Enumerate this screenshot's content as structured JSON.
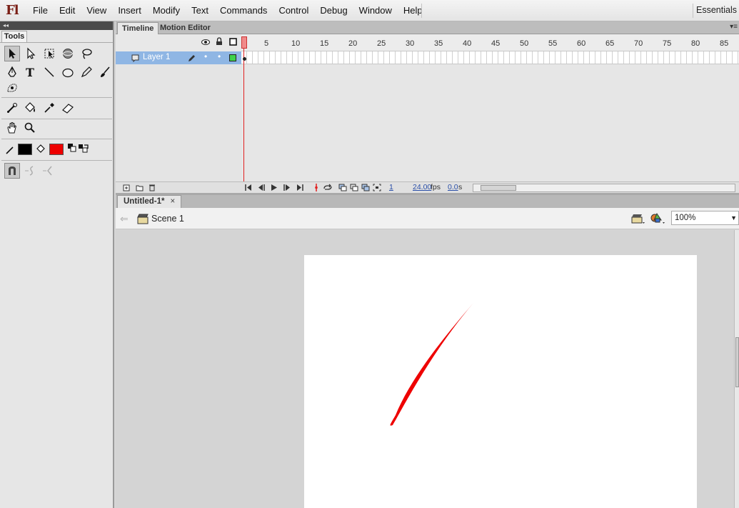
{
  "app": {
    "logo": "Fl",
    "workspace": "Essentials"
  },
  "menu": [
    "File",
    "Edit",
    "View",
    "Insert",
    "Modify",
    "Text",
    "Commands",
    "Control",
    "Debug",
    "Window",
    "Help"
  ],
  "tools": {
    "tab_label": "Tools",
    "stroke_color": "#000000",
    "fill_color": "#ee0000"
  },
  "timeline": {
    "tabs": [
      "Timeline",
      "Motion Editor"
    ],
    "ruler": [
      "1",
      "5",
      "10",
      "15",
      "20",
      "25",
      "30",
      "35",
      "40",
      "45",
      "50",
      "55",
      "60",
      "65",
      "70",
      "75",
      "80",
      "85"
    ],
    "layer_name": "Layer 1",
    "current_frame": "1",
    "fps": "24.00",
    "fps_unit": "fps",
    "time": "0.0",
    "time_unit": "s"
  },
  "document": {
    "tab": "Untitled-1*",
    "tab_close": "×",
    "scene": "Scene 1",
    "zoom": "100%",
    "stroke_color": "#ee0000"
  }
}
